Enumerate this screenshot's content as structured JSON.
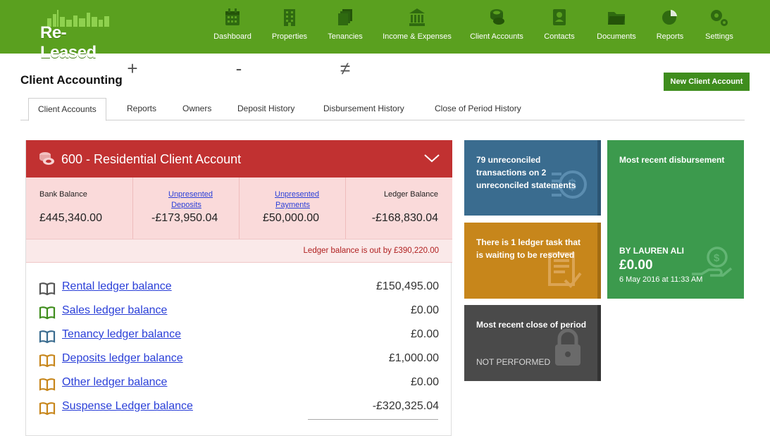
{
  "brand": {
    "name": "Re-Leased",
    "color": "#5aa01f"
  },
  "nav": [
    {
      "label": "Dashboard",
      "icon": "calendar-icon"
    },
    {
      "label": "Properties",
      "icon": "building-icon"
    },
    {
      "label": "Tenancies",
      "icon": "documents-stack-icon"
    },
    {
      "label": "Income & Expenses",
      "icon": "bank-icon"
    },
    {
      "label": "Client Accounts",
      "icon": "coins-icon"
    },
    {
      "label": "Contacts",
      "icon": "contact-card-icon"
    },
    {
      "label": "Documents",
      "icon": "folder-icon"
    },
    {
      "label": "Reports",
      "icon": "pie-chart-icon"
    },
    {
      "label": "Settings",
      "icon": "gears-icon"
    }
  ],
  "page": {
    "title": "Client Accounting",
    "new_button": "New Client Account"
  },
  "tabs": [
    {
      "label": "Client Accounts",
      "active": true
    },
    {
      "label": "Reports",
      "active": false
    },
    {
      "label": "Owners",
      "active": false
    },
    {
      "label": "Deposit History",
      "active": false
    },
    {
      "label": "Disbursement History",
      "active": false
    },
    {
      "label": "Close of Period History",
      "active": false
    }
  ],
  "account": {
    "title": "600 - Residential Client Account",
    "header_color": "#c13131",
    "balances": {
      "bank_label": "Bank Balance",
      "bank_value": "£445,340.00",
      "unpresented_deposits_label": "Unpresented Deposits",
      "unpresented_deposits_value": "-£173,950.04",
      "unpresented_payments_label": "Unpresented Payments",
      "unpresented_payments_value": "£50,000.00",
      "ledger_label": "Ledger Balance",
      "ledger_value": "-£168,830.04",
      "op_plus": "+",
      "op_minus": "-",
      "op_noteq": "≠"
    },
    "out_message": "Ledger balance is out by £390,220.00",
    "ledgers": [
      {
        "label": "Rental ledger balance",
        "amount": "£150,495.00",
        "icon_color": "#555555"
      },
      {
        "label": "Sales ledger balance",
        "amount": "£0.00",
        "icon_color": "#3f8d1d"
      },
      {
        "label": "Tenancy ledger balance",
        "amount": "£0.00",
        "icon_color": "#3a6c8f"
      },
      {
        "label": "Deposits ledger balance",
        "amount": "£1,000.00",
        "icon_color": "#c7861b"
      },
      {
        "label": "Other ledger balance",
        "amount": "£0.00",
        "icon_color": "#c7861b"
      },
      {
        "label": "Suspense Ledger balance",
        "amount": "-£320,325.04",
        "icon_color": "#c7861b"
      }
    ]
  },
  "tiles": {
    "unreconciled": {
      "text": "79 unreconciled transactions on 2 unreconciled statements",
      "color": "#3a6c8f"
    },
    "ledger_task": {
      "text": "There is 1 ledger task that is waiting to be resolved",
      "color": "#c7861b"
    },
    "close_period": {
      "title": "Most recent close of period",
      "status": "NOT PERFORMED",
      "color": "#4a4a4a"
    },
    "disbursement": {
      "title": "Most recent disbursement",
      "by": "BY LAUREN ALI",
      "amount": "£0.00",
      "date": "6 May 2016 at 11:33 AM",
      "color": "#3c9a4d"
    }
  }
}
